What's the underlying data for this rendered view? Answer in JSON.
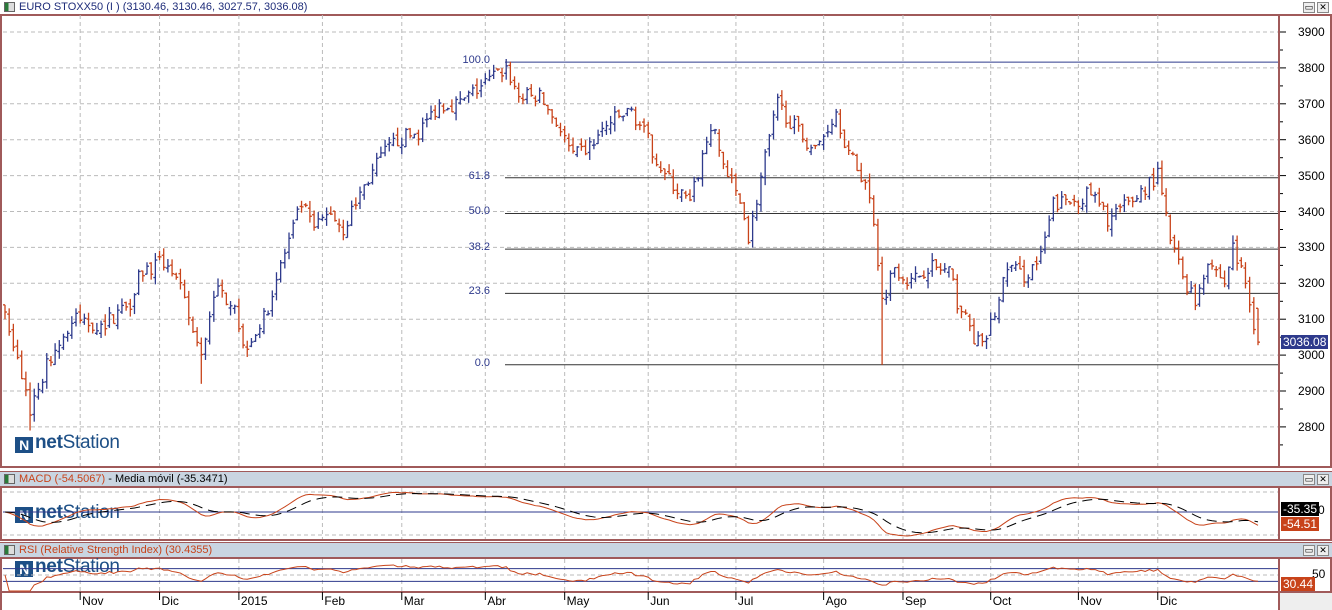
{
  "window": {
    "icon": "chart-window-icon",
    "title": "EURO STOXX50 (I ) (3130.46, 3130.46, 3027.57, 3036.08)",
    "minimize_icon": "restore-icon",
    "close_icon": "close-icon",
    "close_glyph": "✕",
    "restore_glyph": "▭"
  },
  "logo_text_a": "net",
  "logo_text_b": "Station",
  "colors": {
    "up": "#2e3a8c",
    "down": "#c8431a",
    "fib": "#2e3a8c",
    "frame": "#a05a5a",
    "macd": "#c8431a",
    "signal": "#000000",
    "rsi": "#c8431a"
  },
  "chart_data": [
    {
      "type": "ohlc",
      "title": "EURO STOXX50 (I )",
      "last_bar": {
        "open": 3130.46,
        "high": 3130.46,
        "low": 3027.57,
        "close": 3036.08
      },
      "last_price_label": "3036.08",
      "ylim": [
        2700,
        3930
      ],
      "yticks": [
        "3900",
        "3800",
        "3700",
        "3600",
        "3500",
        "3400",
        "3300",
        "3200",
        "3100",
        "3000",
        "2900",
        "2800"
      ],
      "ytick_values": [
        3900,
        3800,
        3700,
        3600,
        3500,
        3400,
        3300,
        3200,
        3100,
        3000,
        2900,
        2800
      ],
      "bar_count": 301,
      "close_path": [
        [
          0,
          3120
        ],
        [
          6,
          2850
        ],
        [
          11,
          3000
        ],
        [
          17,
          3100
        ],
        [
          23,
          3080
        ],
        [
          30,
          3150
        ],
        [
          32,
          3230
        ],
        [
          39,
          3260
        ],
        [
          42,
          3180
        ],
        [
          47,
          2990
        ],
        [
          50,
          3180
        ],
        [
          55,
          3150
        ],
        [
          57,
          3020
        ],
        [
          62,
          3100
        ],
        [
          66,
          3250
        ],
        [
          71,
          3420
        ],
        [
          74,
          3350
        ],
        [
          78,
          3400
        ],
        [
          81,
          3350
        ],
        [
          85,
          3450
        ],
        [
          90,
          3550
        ],
        [
          94,
          3600
        ],
        [
          99,
          3620
        ],
        [
          104,
          3700
        ],
        [
          109,
          3700
        ],
        [
          114,
          3750
        ],
        [
          120,
          3800
        ],
        [
          123,
          3720
        ],
        [
          128,
          3720
        ],
        [
          132,
          3650
        ],
        [
          136,
          3550
        ],
        [
          140,
          3580
        ],
        [
          145,
          3650
        ],
        [
          150,
          3680
        ],
        [
          153,
          3620
        ],
        [
          158,
          3500
        ],
        [
          164,
          3420
        ],
        [
          169,
          3640
        ],
        [
          173,
          3500
        ],
        [
          177,
          3400
        ],
        [
          178,
          3320
        ],
        [
          182,
          3550
        ],
        [
          185,
          3700
        ],
        [
          190,
          3620
        ],
        [
          194,
          3570
        ],
        [
          199,
          3680
        ],
        [
          202,
          3560
        ],
        [
          206,
          3480
        ],
        [
          208,
          3380
        ],
        [
          210,
          3150
        ],
        [
          213,
          3250
        ],
        [
          217,
          3200
        ],
        [
          221,
          3250
        ],
        [
          226,
          3230
        ],
        [
          228,
          3150
        ],
        [
          232,
          3050
        ],
        [
          234,
          3020
        ],
        [
          238,
          3150
        ],
        [
          240,
          3250
        ],
        [
          244,
          3220
        ],
        [
          248,
          3270
        ],
        [
          251,
          3420
        ],
        [
          256,
          3430
        ],
        [
          260,
          3450
        ],
        [
          264,
          3380
        ],
        [
          269,
          3420
        ],
        [
          274,
          3480
        ],
        [
          276,
          3500
        ],
        [
          279,
          3320
        ],
        [
          282,
          3220
        ],
        [
          285,
          3150
        ],
        [
          288,
          3270
        ],
        [
          292,
          3200
        ],
        [
          294,
          3300
        ],
        [
          297,
          3200
        ],
        [
          300,
          3036
        ]
      ],
      "low_spikes": [
        [
          6,
          2790
        ],
        [
          47,
          2920
        ],
        [
          210,
          2973
        ]
      ],
      "fibonacci": {
        "high": 3816,
        "low": 2973,
        "levels": [
          {
            "label": "100.0",
            "ratio": 1.0
          },
          {
            "label": "61.8",
            "ratio": 0.618
          },
          {
            "label": "50.0",
            "ratio": 0.5
          },
          {
            "label": "38.2",
            "ratio": 0.382
          },
          {
            "label": "23.6",
            "ratio": 0.236
          },
          {
            "label": "0.0",
            "ratio": 0.0
          }
        ]
      },
      "grid": true
    },
    {
      "type": "line",
      "title": "MACD",
      "header_macd": "MACD (-54.5067)",
      "header_sep": " - ",
      "header_signal": "Media móvil (-35.3471)",
      "series": [
        {
          "name": "MACD",
          "last": -54.5067
        },
        {
          "name": "Media móvil",
          "last": -35.3471
        }
      ],
      "labels": {
        "signal": "-35.35",
        "macd": "-54.51",
        "zero": "0"
      }
    },
    {
      "type": "line",
      "title": "RSI (Relative Strength Index) (30.4355)",
      "series": [
        {
          "name": "RSI",
          "last": 30.4355
        }
      ],
      "ylim": [
        0,
        100
      ],
      "levels": [
        30,
        70
      ],
      "labels": {
        "rsi": "30.44",
        "fifty": "50"
      }
    }
  ],
  "xaxis": {
    "months": [
      {
        "label": "Nov",
        "bar": 18
      },
      {
        "label": "Dic",
        "bar": 37
      },
      {
        "label": "2015",
        "bar": 56
      },
      {
        "label": "Feb",
        "bar": 76
      },
      {
        "label": "Mar",
        "bar": 95
      },
      {
        "label": "Abr",
        "bar": 115
      },
      {
        "label": "May",
        "bar": 134
      },
      {
        "label": "Jun",
        "bar": 154
      },
      {
        "label": "Jul",
        "bar": 175
      },
      {
        "label": "Ago",
        "bar": 196
      },
      {
        "label": "Sep",
        "bar": 215
      },
      {
        "label": "Oct",
        "bar": 236
      },
      {
        "label": "Nov",
        "bar": 257
      },
      {
        "label": "Dic",
        "bar": 276
      }
    ]
  }
}
